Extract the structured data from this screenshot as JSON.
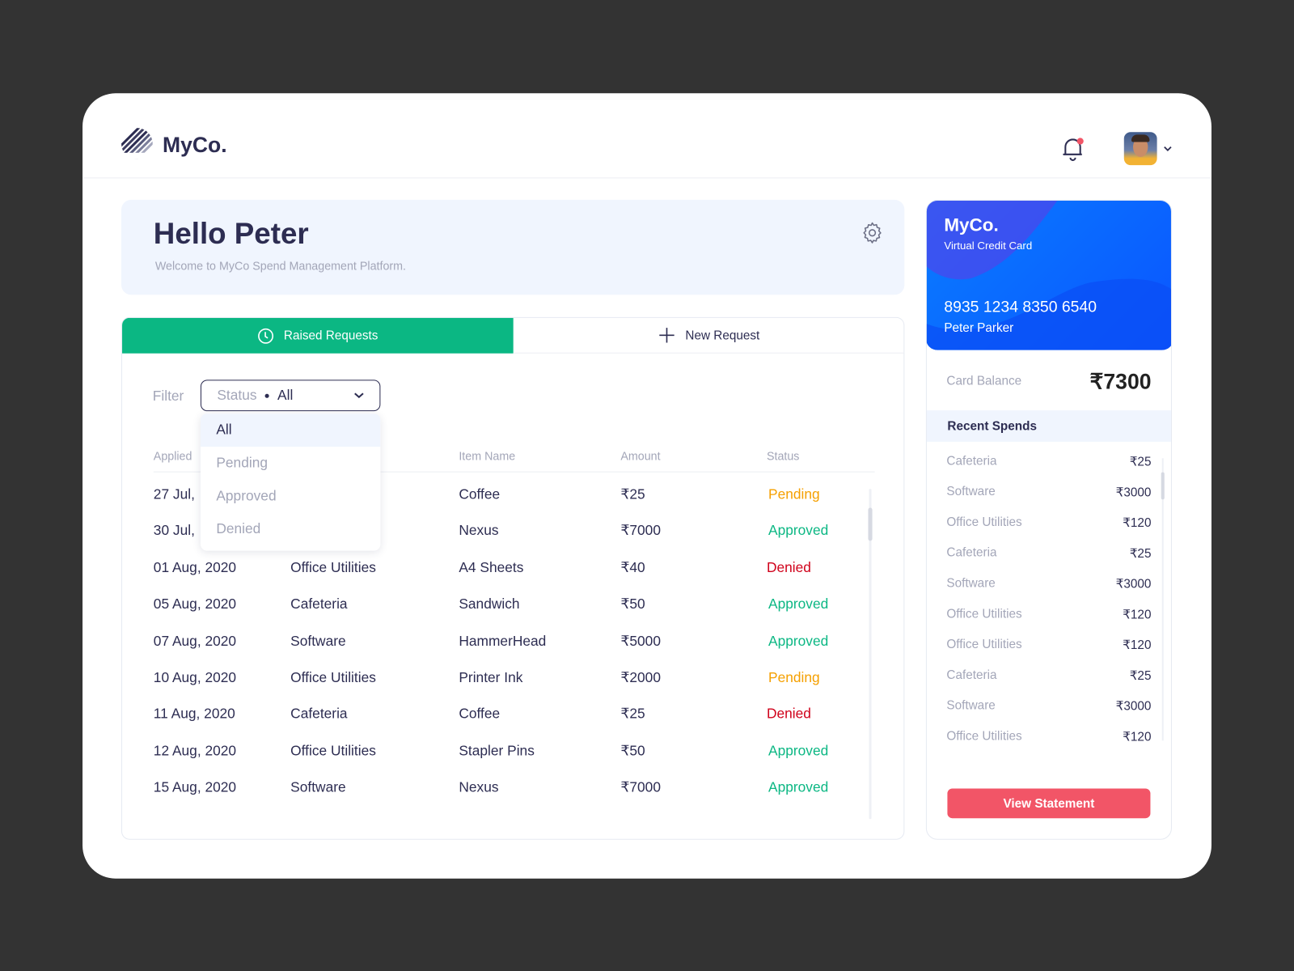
{
  "header": {
    "brand": "MyCo.",
    "notification_icon": "bell-icon",
    "has_unread": true,
    "avatar_icon": "user-avatar"
  },
  "welcome": {
    "title": "Hello Peter",
    "subtitle": "Welcome to MyCo Spend Management Platform."
  },
  "tabs": [
    {
      "label": "Raised Requests",
      "icon": "clock-icon",
      "active": true
    },
    {
      "label": "New Request",
      "icon": "plus-icon",
      "active": false
    }
  ],
  "filter": {
    "label": "Filter",
    "key": "Status",
    "value": "All",
    "options": [
      "All",
      "Pending",
      "Approved",
      "Denied"
    ]
  },
  "table": {
    "headers": [
      "Applied",
      "",
      "Item Name",
      "Amount",
      "Status"
    ],
    "rows": [
      [
        "27 Jul,",
        "",
        "Coffee",
        "₹25",
        "Pending"
      ],
      [
        "30 Jul,",
        "",
        "Nexus",
        "₹7000",
        "Approved"
      ],
      [
        "01 Aug, 2020",
        "Office Utilities",
        "A4 Sheets",
        "₹40",
        "Denied"
      ],
      [
        "05 Aug, 2020",
        "Cafeteria",
        "Sandwich",
        "₹50",
        "Approved"
      ],
      [
        "07 Aug, 2020",
        "Software",
        "HammerHead",
        "₹5000",
        "Approved"
      ],
      [
        "10 Aug, 2020",
        "Office Utilities",
        "Printer Ink",
        "₹2000",
        "Pending"
      ],
      [
        "11 Aug, 2020",
        "Cafeteria",
        "Coffee",
        "₹25",
        "Denied"
      ],
      [
        "12 Aug, 2020",
        "Office Utilities",
        "Stapler Pins",
        "₹50",
        "Approved"
      ],
      [
        "15 Aug, 2020",
        "Software",
        "Nexus",
        "₹7000",
        "Approved"
      ]
    ]
  },
  "status_colors": {
    "Pending": "#f5a000",
    "Approved": "#0bb783",
    "Denied": "#d0021b"
  },
  "card": {
    "brand": "MyCo.",
    "type": "Virtual Credit Card",
    "number": "8935 1234 8350 6540",
    "holder": "Peter Parker",
    "balance_label": "Card Balance",
    "balance": "₹7300"
  },
  "recent": {
    "title": "Recent Spends",
    "items": [
      [
        "Cafeteria",
        "₹25"
      ],
      [
        "Software",
        "₹3000"
      ],
      [
        "Office Utilities",
        "₹120"
      ],
      [
        "Cafeteria",
        "₹25"
      ],
      [
        "Software",
        "₹3000"
      ],
      [
        "Office Utilities",
        "₹120"
      ],
      [
        "Office Utilities",
        "₹120"
      ],
      [
        "Cafeteria",
        "₹25"
      ],
      [
        "Software",
        "₹3000"
      ],
      [
        "Office Utilities",
        "₹120"
      ]
    ]
  },
  "view_statement": "View Statement",
  "colors": {
    "accent": "#0bb783",
    "primary_text": "#2d2d52",
    "button": "#f25567",
    "card": "#0a66ff"
  }
}
